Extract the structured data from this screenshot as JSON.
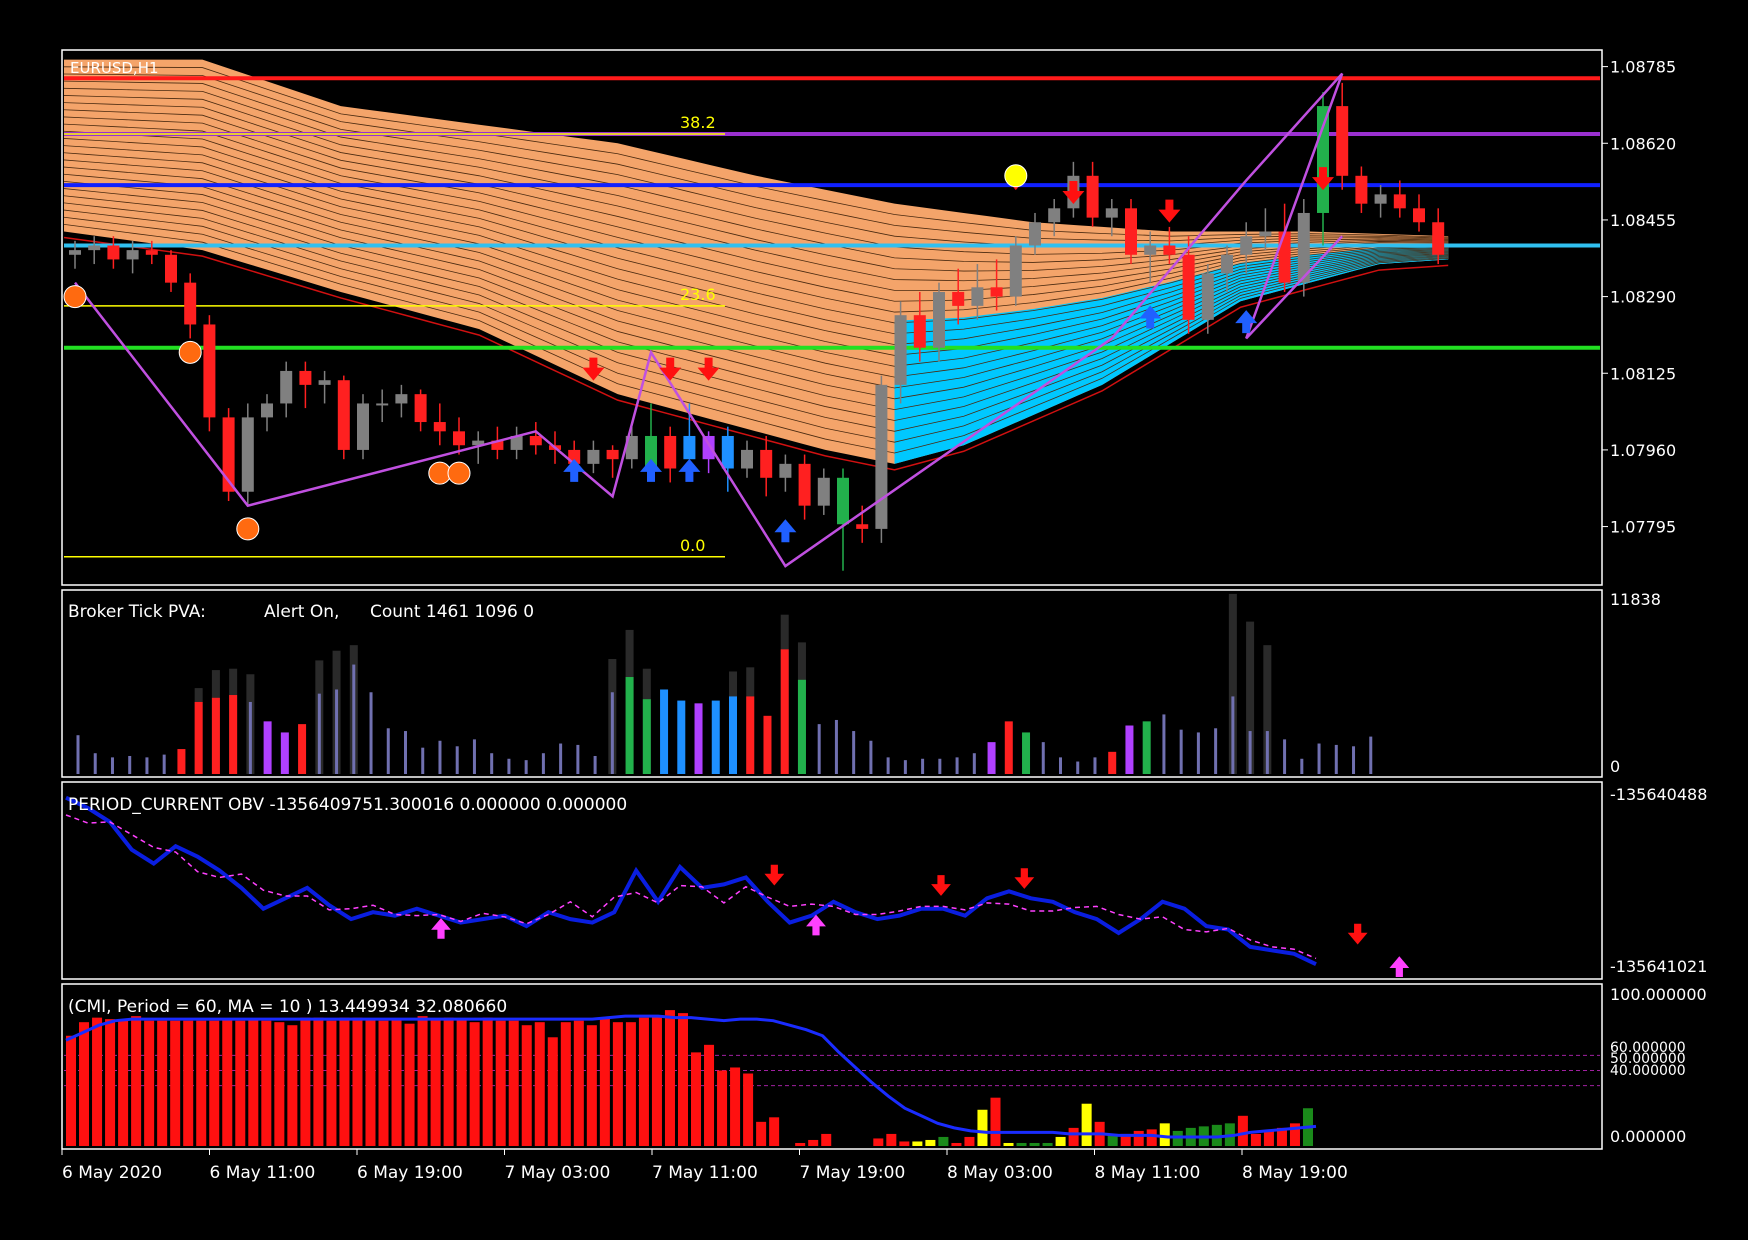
{
  "colors": {
    "background": "#000000",
    "frame": "#ffffff",
    "text": "#ffffff",
    "bull_candle": "#808080",
    "bear_candle": "#ff2020",
    "green_candle": "#22b14c",
    "blue_candle": "#1e90ff",
    "ribbon": "#f4a46a",
    "ribbon_line": "#4a2a10",
    "cyan_ribbon": "#00c8ff",
    "zigzag": "#c050e0",
    "fib": "#ffff00",
    "sell_arrow": "#ff1010",
    "buy_arrow": "#2060ff",
    "pva_neutral": "#7070b0",
    "pva_violet": "#b040ff",
    "obv_line": "#0a1ee0",
    "obv_signal": "#ff40ff",
    "cmi_bar": "#ff1010",
    "cmi_ma": "#1a2cff",
    "cmi_yellow": "#ffff00",
    "cmi_green": "#1a8a1a",
    "level_red": "#ff1a1a",
    "level_purple": "#9a30d0",
    "level_blue": "#1020ff",
    "level_cyan": "#30c0f0",
    "level_green": "#22e022"
  },
  "main": {
    "symbol_label": "EURUSD,H1",
    "price_axis": [
      "1.08785",
      "1.08620",
      "1.08455",
      "1.08290",
      "1.08125",
      "1.07960",
      "1.07795"
    ],
    "fib_labels": [
      "38.2",
      "23.6",
      "0.0"
    ],
    "ribbon": {
      "lower": [
        [
          0,
          1.0843
        ],
        [
          0.1,
          1.0839
        ],
        [
          0.2,
          1.083
        ],
        [
          0.3,
          1.0822
        ],
        [
          0.4,
          1.0808
        ],
        [
          0.5,
          1.08
        ],
        [
          0.55,
          1.0796
        ],
        [
          0.6,
          1.0793
        ],
        [
          0.65,
          1.0797
        ],
        [
          0.75,
          1.081
        ],
        [
          0.85,
          1.0828
        ],
        [
          0.95,
          1.0836
        ],
        [
          1,
          1.0837
        ]
      ],
      "upper": [
        [
          0,
          1.088
        ],
        [
          0.1,
          1.088
        ],
        [
          0.2,
          1.087
        ],
        [
          0.3,
          1.0866
        ],
        [
          0.4,
          1.0862
        ],
        [
          0.5,
          1.0855
        ],
        [
          0.6,
          1.0849
        ],
        [
          0.7,
          1.0845
        ],
        [
          0.8,
          1.0843
        ],
        [
          0.9,
          1.0843
        ],
        [
          1,
          1.0842
        ]
      ]
    },
    "levels": [
      {
        "price": 1.0876,
        "color": "#ff1a1a"
      },
      {
        "price": 1.0864,
        "color": "#9a30d0"
      },
      {
        "price": 1.0853,
        "color": "#1020ff"
      },
      {
        "price": 1.084,
        "color": "#30c0f0"
      },
      {
        "price": 1.0818,
        "color": "#22e022"
      }
    ],
    "fib_levels": [
      {
        "price": 1.0864,
        "label": "38.2"
      },
      {
        "price": 1.0827,
        "label": "23.6"
      },
      {
        "price": 1.0773,
        "label": "0.0"
      }
    ],
    "candles": [
      {
        "o": 1.0838,
        "h": 1.0841,
        "l": 1.0835,
        "c": 1.0839
      },
      {
        "o": 1.0839,
        "h": 1.0842,
        "l": 1.0836,
        "c": 1.084
      },
      {
        "o": 1.084,
        "h": 1.0842,
        "l": 1.0835,
        "c": 1.0837
      },
      {
        "o": 1.0837,
        "h": 1.0841,
        "l": 1.0834,
        "c": 1.0839
      },
      {
        "o": 1.0839,
        "h": 1.0841,
        "l": 1.0836,
        "c": 1.0838
      },
      {
        "o": 1.0838,
        "h": 1.0839,
        "l": 1.083,
        "c": 1.0832
      },
      {
        "o": 1.0832,
        "h": 1.0834,
        "l": 1.082,
        "c": 1.0823
      },
      {
        "o": 1.0823,
        "h": 1.0825,
        "l": 1.08,
        "c": 1.0803
      },
      {
        "o": 1.0803,
        "h": 1.0805,
        "l": 1.0785,
        "c": 1.0787
      },
      {
        "o": 1.0787,
        "h": 1.0806,
        "l": 1.0784,
        "c": 1.0803
      },
      {
        "o": 1.0803,
        "h": 1.0808,
        "l": 1.08,
        "c": 1.0806
      },
      {
        "o": 1.0806,
        "h": 1.0815,
        "l": 1.0803,
        "c": 1.0813
      },
      {
        "o": 1.0813,
        "h": 1.0815,
        "l": 1.0805,
        "c": 1.081
      },
      {
        "o": 1.081,
        "h": 1.0813,
        "l": 1.0806,
        "c": 1.0811
      },
      {
        "o": 1.0811,
        "h": 1.0812,
        "l": 1.0794,
        "c": 1.0796
      },
      {
        "o": 1.0796,
        "h": 1.0808,
        "l": 1.0794,
        "c": 1.0806
      },
      {
        "o": 1.0806,
        "h": 1.0809,
        "l": 1.0802,
        "c": 1.0806
      },
      {
        "o": 1.0806,
        "h": 1.081,
        "l": 1.0803,
        "c": 1.0808
      },
      {
        "o": 1.0808,
        "h": 1.0809,
        "l": 1.08,
        "c": 1.0802
      },
      {
        "o": 1.0802,
        "h": 1.0806,
        "l": 1.0797,
        "c": 1.08
      },
      {
        "o": 1.08,
        "h": 1.0803,
        "l": 1.0795,
        "c": 1.0797
      },
      {
        "o": 1.0797,
        "h": 1.08,
        "l": 1.0793,
        "c": 1.0798
      },
      {
        "o": 1.0798,
        "h": 1.0801,
        "l": 1.0794,
        "c": 1.0796
      },
      {
        "o": 1.0796,
        "h": 1.0801,
        "l": 1.0794,
        "c": 1.0799
      },
      {
        "o": 1.0799,
        "h": 1.0802,
        "l": 1.0795,
        "c": 1.0797
      },
      {
        "o": 1.0797,
        "h": 1.08,
        "l": 1.0793,
        "c": 1.0796
      },
      {
        "o": 1.0796,
        "h": 1.0798,
        "l": 1.0792,
        "c": 1.0793
      },
      {
        "o": 1.0793,
        "h": 1.0798,
        "l": 1.0791,
        "c": 1.0796
      },
      {
        "o": 1.0796,
        "h": 1.0797,
        "l": 1.079,
        "c": 1.0794
      },
      {
        "o": 1.0794,
        "h": 1.0801,
        "l": 1.0792,
        "c": 1.0799
      },
      {
        "o": 1.0799,
        "h": 1.0806,
        "l": 1.079,
        "c": 1.0792
      },
      {
        "o": 1.0792,
        "h": 1.0801,
        "l": 1.0789,
        "c": 1.0799
      },
      {
        "o": 1.0799,
        "h": 1.0806,
        "l": 1.0794,
        "c": 1.0794
      },
      {
        "o": 1.0794,
        "h": 1.08,
        "l": 1.0791,
        "c": 1.0799
      },
      {
        "o": 1.0799,
        "h": 1.0801,
        "l": 1.0787,
        "c": 1.0792
      },
      {
        "o": 1.0792,
        "h": 1.0798,
        "l": 1.079,
        "c": 1.0796
      },
      {
        "o": 1.0796,
        "h": 1.0799,
        "l": 1.0786,
        "c": 1.079
      },
      {
        "o": 1.079,
        "h": 1.0795,
        "l": 1.0787,
        "c": 1.0793
      },
      {
        "o": 1.0793,
        "h": 1.0795,
        "l": 1.0781,
        "c": 1.0784
      },
      {
        "o": 1.0784,
        "h": 1.0792,
        "l": 1.0782,
        "c": 1.079
      },
      {
        "o": 1.079,
        "h": 1.0792,
        "l": 1.077,
        "c": 1.078
      },
      {
        "o": 1.078,
        "h": 1.0784,
        "l": 1.0776,
        "c": 1.0779
      },
      {
        "o": 1.0779,
        "h": 1.0812,
        "l": 1.0776,
        "c": 1.081
      },
      {
        "o": 1.081,
        "h": 1.0828,
        "l": 1.0806,
        "c": 1.0825
      },
      {
        "o": 1.0825,
        "h": 1.083,
        "l": 1.0815,
        "c": 1.0818
      },
      {
        "o": 1.0818,
        "h": 1.0832,
        "l": 1.0815,
        "c": 1.083
      },
      {
        "o": 1.083,
        "h": 1.0835,
        "l": 1.0823,
        "c": 1.0827
      },
      {
        "o": 1.0827,
        "h": 1.0836,
        "l": 1.0824,
        "c": 1.0831
      },
      {
        "o": 1.0831,
        "h": 1.0837,
        "l": 1.0826,
        "c": 1.0829
      },
      {
        "o": 1.0829,
        "h": 1.0842,
        "l": 1.0827,
        "c": 1.084
      },
      {
        "o": 1.084,
        "h": 1.0847,
        "l": 1.0838,
        "c": 1.0845
      },
      {
        "o": 1.0845,
        "h": 1.085,
        "l": 1.0842,
        "c": 1.0848
      },
      {
        "o": 1.0848,
        "h": 1.0858,
        "l": 1.0846,
        "c": 1.0855
      },
      {
        "o": 1.0855,
        "h": 1.0858,
        "l": 1.0844,
        "c": 1.0846
      },
      {
        "o": 1.0846,
        "h": 1.085,
        "l": 1.0842,
        "c": 1.0848
      },
      {
        "o": 1.0848,
        "h": 1.085,
        "l": 1.0836,
        "c": 1.0838
      },
      {
        "o": 1.0838,
        "h": 1.0843,
        "l": 1.0832,
        "c": 1.084
      },
      {
        "o": 1.084,
        "h": 1.0844,
        "l": 1.0836,
        "c": 1.0838
      },
      {
        "o": 1.0838,
        "h": 1.0842,
        "l": 1.0821,
        "c": 1.0824
      },
      {
        "o": 1.0824,
        "h": 1.0836,
        "l": 1.0821,
        "c": 1.0834
      },
      {
        "o": 1.0834,
        "h": 1.084,
        "l": 1.083,
        "c": 1.0838
      },
      {
        "o": 1.0838,
        "h": 1.0845,
        "l": 1.0834,
        "c": 1.0842
      },
      {
        "o": 1.0842,
        "h": 1.0848,
        "l": 1.0839,
        "c": 1.0843
      },
      {
        "o": 1.0843,
        "h": 1.0849,
        "l": 1.083,
        "c": 1.0832
      },
      {
        "o": 1.0832,
        "h": 1.085,
        "l": 1.0829,
        "c": 1.0847
      },
      {
        "o": 1.0847,
        "h": 1.0873,
        "l": 1.084,
        "c": 1.087
      },
      {
        "o": 1.087,
        "h": 1.0875,
        "l": 1.0852,
        "c": 1.0855
      },
      {
        "o": 1.0855,
        "h": 1.0857,
        "l": 1.0847,
        "c": 1.0849
      },
      {
        "o": 1.0849,
        "h": 1.0853,
        "l": 1.0846,
        "c": 1.0851
      },
      {
        "o": 1.0851,
        "h": 1.0854,
        "l": 1.0846,
        "c": 1.0848
      },
      {
        "o": 1.0848,
        "h": 1.0851,
        "l": 1.0843,
        "c": 1.0845
      },
      {
        "o": 1.0845,
        "h": 1.0848,
        "l": 1.0836,
        "c": 1.0838
      }
    ],
    "candle_colors": {
      "8": "red",
      "9": "gray",
      "30": "green",
      "31": "red",
      "32": "blue",
      "33": "violet",
      "34": "blue",
      "35": "gray",
      "38": "red",
      "39": "gray",
      "40": "green",
      "65": "green"
    },
    "zigzag": [
      [
        0,
        1.0832
      ],
      [
        9,
        1.0784
      ],
      [
        24,
        1.08
      ],
      [
        28,
        1.0786
      ],
      [
        30,
        1.0817
      ],
      [
        37,
        1.0771
      ],
      [
        54,
        1.082
      ],
      [
        61,
        1.0854
      ],
      [
        66,
        1.0877
      ],
      [
        61,
        1.082
      ],
      [
        66,
        1.0842
      ]
    ],
    "sell_arrows": [
      [
        27,
        1.0812
      ],
      [
        31,
        1.0812
      ],
      [
        33,
        1.0812
      ],
      [
        49,
        1.0853
      ],
      [
        52,
        1.085
      ],
      [
        57,
        1.0846
      ],
      [
        65,
        1.0853
      ]
    ],
    "buy_arrows": [
      [
        26,
        1.0793
      ],
      [
        30,
        1.0793
      ],
      [
        32,
        1.0793
      ],
      [
        37,
        1.078
      ],
      [
        56,
        1.0826
      ],
      [
        61,
        1.0825
      ]
    ],
    "circle_marks": [
      [
        0,
        1.0829
      ],
      [
        6,
        1.0817
      ],
      [
        9,
        1.0779
      ],
      [
        19,
        1.0791
      ],
      [
        20,
        1.0791
      ],
      [
        49,
        1.0855
      ]
    ]
  },
  "pva": {
    "label": "Broker Tick PVA:",
    "alert": "Alert On,",
    "count": "Count  1461 1096 0",
    "axis_top": "11838",
    "axis_bottom": "0",
    "max": 11838,
    "values": [
      2800,
      1500,
      1200,
      1300,
      1200,
      1400,
      1800,
      5200,
      5500,
      5700,
      5200,
      3800,
      3000,
      3600,
      5800,
      6100,
      7900,
      5900,
      3300,
      3100,
      1900,
      2400,
      2000,
      2500,
      1500,
      1100,
      1000,
      1500,
      2200,
      2100,
      1300,
      5900,
      7000,
      5400,
      6100,
      5300,
      5100,
      5300,
      5600,
      5600,
      4200,
      9000,
      6800,
      3600,
      3900,
      3100,
      2400,
      1200,
      1000,
      1100,
      1100,
      1200,
      1500,
      2300,
      3800,
      3000,
      2300,
      1200,
      900,
      1200,
      1600,
      3500,
      3800,
      4300,
      3200,
      3000,
      3300,
      5600,
      3100,
      3100,
      2500,
      1100,
      2200,
      2100,
      2000,
      2700
    ],
    "ghost": [
      0,
      0,
      0,
      0,
      0,
      0,
      0,
      6200,
      7500,
      7600,
      7200,
      0,
      0,
      0,
      8200,
      8900,
      9300,
      0,
      0,
      0,
      0,
      0,
      0,
      0,
      0,
      0,
      0,
      0,
      0,
      0,
      0,
      8300,
      10400,
      7600,
      0,
      0,
      0,
      0,
      7400,
      7700,
      0,
      11500,
      9500,
      0,
      0,
      0,
      0,
      0,
      0,
      0,
      0,
      0,
      0,
      0,
      0,
      0,
      0,
      0,
      0,
      0,
      0,
      0,
      0,
      0,
      0,
      0,
      0,
      13000,
      11000,
      9300,
      0,
      0,
      0,
      0,
      0,
      0
    ],
    "colors": {
      "6": "red",
      "7": "red",
      "8": "red",
      "9": "red",
      "11": "violet",
      "12": "violet",
      "13": "red",
      "32": "green",
      "33": "green",
      "34": "blue",
      "35": "blue",
      "36": "violet",
      "37": "blue",
      "38": "blue",
      "39": "red",
      "40": "red",
      "41": "red",
      "42": "green",
      "53": "violet",
      "54": "red",
      "55": "green",
      "60": "red",
      "61": "violet",
      "62": "green"
    }
  },
  "obv": {
    "label": "PERIOD_CURRENT OBV -1356409751.300016 0.000000 0.000000",
    "axis_top": "-135640488",
    "axis_bottom": "-135641021",
    "values": [
      -135640510,
      -135640540,
      -135640580,
      -135640660,
      -135640700,
      -135640650,
      -135640680,
      -135640720,
      -135640770,
      -135640830,
      -135640800,
      -135640770,
      -135640820,
      -135640860,
      -135640840,
      -135640850,
      -135640830,
      -135640850,
      -135640870,
      -135640860,
      -135640850,
      -135640880,
      -135640840,
      -135640860,
      -135640870,
      -135640840,
      -135640720,
      -135640810,
      -135640710,
      -135640770,
      -135640760,
      -135640740,
      -135640810,
      -135640870,
      -135640850,
      -135640810,
      -135640840,
      -135640860,
      -135640850,
      -135640830,
      -135640830,
      -135640850,
      -135640800,
      -135640780,
      -135640800,
      -135640810,
      -135640840,
      -135640860,
      -135640900,
      -135640860,
      -135640810,
      -135640830,
      -135640880,
      -135640890,
      -135640940,
      -135640950,
      -135640960,
      -135640990
    ],
    "sell_arrows": [
      [
        34,
        -135640750
      ],
      [
        42,
        -135640780
      ],
      [
        46,
        -135640760
      ],
      [
        62,
        -135640920
      ]
    ],
    "buy_arrows": [
      [
        18,
        -135640870
      ],
      [
        36,
        -135640860
      ],
      [
        64,
        -135640980
      ]
    ]
  },
  "cmi": {
    "label": "(CMI, Period = 60, MA = 10 ) 13.449934 32.080660",
    "axis": [
      "100.000000",
      "60.000000",
      "50.000000",
      "40.000000",
      "0.000000"
    ],
    "bars": [
      73,
      82,
      85,
      84,
      83,
      86,
      83,
      83,
      83,
      83,
      83,
      83,
      84,
      83,
      84,
      83,
      82,
      80,
      85,
      85,
      83,
      85,
      85,
      84,
      83,
      84,
      81,
      86,
      84,
      85,
      84,
      82,
      85,
      83,
      83,
      80,
      82,
      72,
      82,
      83,
      80,
      85,
      82,
      82,
      85,
      86,
      90,
      88,
      62,
      67,
      50,
      52,
      48,
      16,
      19,
      0,
      2,
      4,
      8,
      0,
      0,
      0,
      5,
      8,
      3,
      3,
      4,
      6,
      2,
      6,
      24,
      32,
      2,
      2,
      2,
      2,
      6,
      12,
      28,
      16,
      8,
      8,
      10,
      11,
      15,
      10,
      12,
      13,
      14,
      15,
      20,
      8,
      10,
      12,
      15,
      25
    ],
    "bar_colors": {
      "65": "yellow",
      "66": "yellow",
      "67": "green",
      "70": "yellow",
      "72": "yellow",
      "73": "green",
      "74": "green",
      "75": "green",
      "76": "yellow",
      "78": "yellow",
      "80": "green",
      "84": "yellow",
      "85": "green",
      "86": "green",
      "87": "green",
      "88": "green",
      "89": "green",
      "95": "green"
    },
    "ma": [
      70,
      75,
      80,
      83,
      84,
      84,
      84,
      84,
      84,
      84,
      84,
      84,
      84,
      84,
      84,
      84,
      84,
      84,
      84,
      84,
      84,
      84,
      84,
      84,
      84,
      84,
      84,
      84,
      84,
      84,
      84,
      84,
      84,
      85,
      86,
      86,
      86,
      85,
      85,
      84,
      83,
      84,
      84,
      83,
      80,
      77,
      73,
      62,
      52,
      42,
      33,
      25,
      20,
      15,
      12,
      10,
      9,
      9,
      9,
      9,
      9,
      8,
      8,
      8,
      7,
      7,
      7,
      6,
      6,
      6,
      6,
      7,
      9,
      10,
      11,
      12,
      13
    ]
  },
  "xaxis": [
    "6 May 2020",
    "6 May 11:00",
    "6 May 19:00",
    "7 May 03:00",
    "7 May 11:00",
    "7 May 19:00",
    "8 May 03:00",
    "8 May 11:00",
    "8 May 19:00"
  ]
}
